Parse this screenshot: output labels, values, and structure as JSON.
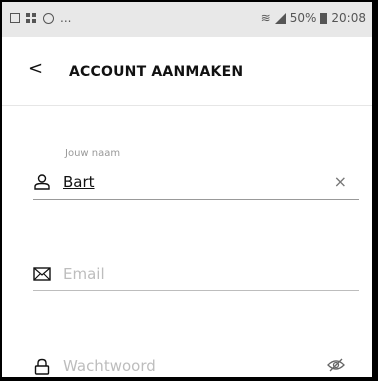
{
  "status_bar": {
    "left_ellipsis": "...",
    "battery": "50%",
    "time": "20:08"
  },
  "header": {
    "back_glyph": "<",
    "title": "ACCOUNT AANMAKEN"
  },
  "form": {
    "name": {
      "label": "Jouw naam",
      "value": "Bart",
      "icon": "person-icon",
      "clear_glyph": "×"
    },
    "email": {
      "placeholder": "Email",
      "icon": "envelope-icon"
    },
    "password": {
      "placeholder": "Wachtwoord",
      "icon": "lock-icon",
      "visibility_icon": "eye-off-icon"
    }
  },
  "colors": {
    "text": "#111111",
    "placeholder": "#bdbdbd",
    "underline": "#bdbdbd",
    "status_bar_bg": "#e8e8e8"
  }
}
